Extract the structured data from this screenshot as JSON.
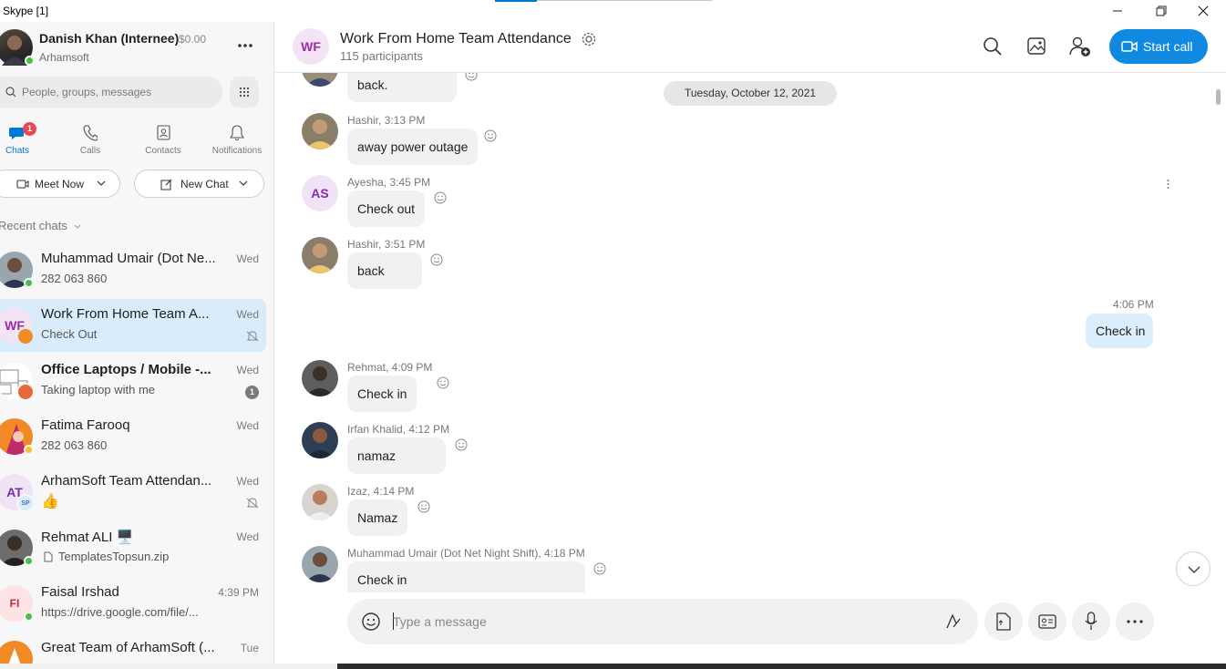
{
  "window": {
    "title": "Skype [1]",
    "controls": [
      "minimize-icon",
      "restore-icon",
      "close-icon"
    ]
  },
  "profile": {
    "name": "Danish Khan (Internee)",
    "credit": "$0.00",
    "org": "Arhamsoft",
    "status": "online"
  },
  "search": {
    "placeholder": "People, groups, messages"
  },
  "nav": {
    "tabs": [
      {
        "label": "Chats",
        "icon": "chat-icon",
        "badge": "1",
        "active": true
      },
      {
        "label": "Calls",
        "icon": "phone-icon"
      },
      {
        "label": "Contacts",
        "icon": "contacts-icon"
      },
      {
        "label": "Notifications",
        "icon": "bell-icon"
      }
    ]
  },
  "actions": {
    "meet_now": "Meet Now",
    "new_chat": "New Chat"
  },
  "recent_label": "Recent chats",
  "chats": [
    {
      "name": "Muhammad Umair (Dot Ne...",
      "preview": "282 063 860",
      "time": "Wed",
      "status": "online"
    },
    {
      "name": "Work From Home Team A...",
      "preview": "Check Out",
      "time": "Wed",
      "initials": "WF",
      "muted": true,
      "active": true
    },
    {
      "name": "Office Laptops / Mobile -...",
      "preview": "Taking laptop with me",
      "time": "Wed",
      "unread": "1",
      "bold": true
    },
    {
      "name": "Fatima Farooq",
      "preview": "282 063 860",
      "time": "Wed",
      "status": "away"
    },
    {
      "name": "ArhamSoft Team Attendan...",
      "preview": "👍",
      "time": "Wed",
      "initials": "AT",
      "sub_initials": "SP",
      "muted": true
    },
    {
      "name": "Rehmat ALI 🖥️",
      "preview": "TemplatesTopsun.zip",
      "time": "Wed",
      "status": "online"
    },
    {
      "name": "Faisal Irshad",
      "preview": "https://drive.google.com/file/...",
      "time": "4:39 PM",
      "initials": "FI",
      "status": "online"
    },
    {
      "name": "Great Team of ArhamSoft (...",
      "preview": "",
      "time": "Tue"
    }
  ],
  "conversation": {
    "initials": "WF",
    "title": "Work From Home Team Attendance",
    "participants": "115 participants",
    "start_call": "Start call",
    "date_separator": "Tuesday, October 12, 2021",
    "messages": [
      {
        "sender": "",
        "time": "",
        "text": "back."
      },
      {
        "sender": "Hashir",
        "time": "3:13 PM",
        "meta": "Hashir, 3:13 PM",
        "text": "away power outage"
      },
      {
        "sender": "Ayesha",
        "time": "3:45 PM",
        "meta": "Ayesha, 3:45 PM",
        "text": "Check out",
        "initials": "AS"
      },
      {
        "sender": "Hashir",
        "time": "3:51 PM",
        "meta": "Hashir, 3:51 PM",
        "text": "back"
      },
      {
        "sender": "me",
        "time": "4:06 PM",
        "text": "Check in",
        "mine": true
      },
      {
        "sender": "Rehmat",
        "time": "4:09 PM",
        "meta": "Rehmat, 4:09 PM",
        "text": "Check in"
      },
      {
        "sender": "Irfan Khalid",
        "time": "4:12 PM",
        "meta": "Irfan Khalid, 4:12 PM",
        "text": "namaz"
      },
      {
        "sender": "Izaz",
        "time": "4:14 PM",
        "meta": "Izaz, 4:14 PM",
        "text": "Namaz"
      },
      {
        "sender": "Muhammad Umair (Dot Net Night Shift)",
        "time": "4:18 PM",
        "meta": "Muhammad Umair (Dot Net Night Shift), 4:18 PM",
        "text": "Check in"
      }
    ]
  },
  "composer": {
    "placeholder": "Type a message"
  },
  "colors": {
    "accent": "#0f8ae0",
    "active_chat_bg": "#d8ecfb",
    "own_bubble": "#dceefc",
    "bubble": "#f1f1f1",
    "online": "#44c047",
    "away": "#f8c22b",
    "badge": "#e74856"
  }
}
